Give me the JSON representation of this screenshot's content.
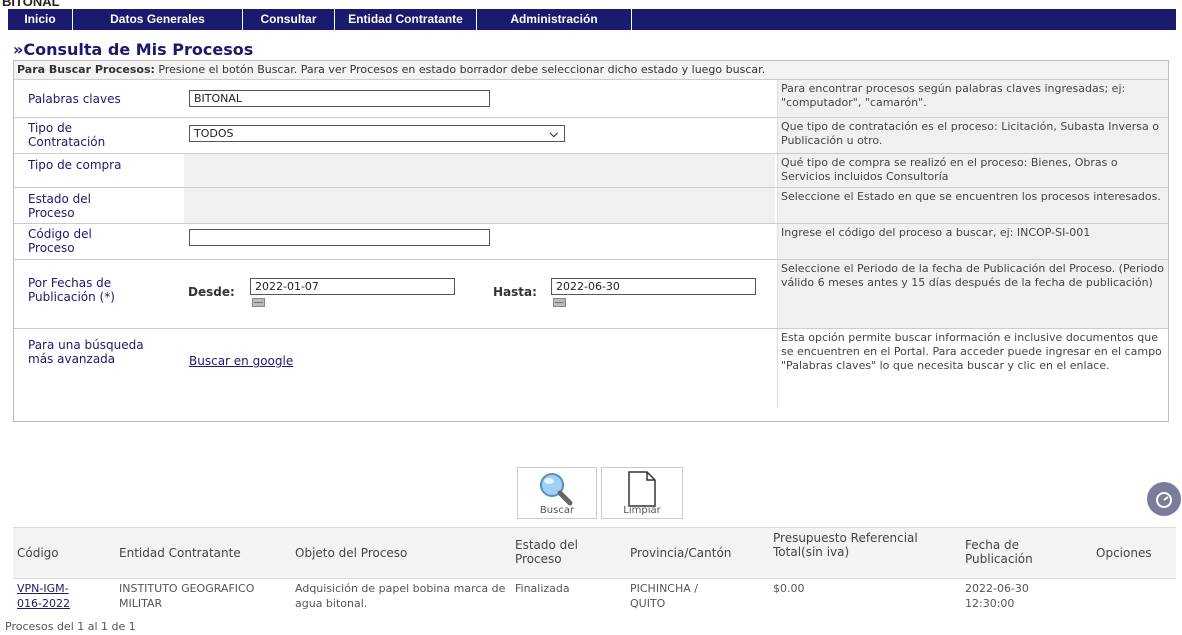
{
  "partial_heading": "BITONAL",
  "nav": [
    "Inicio",
    "Datos Generales",
    "Consultar",
    "Entidad Contratante",
    "Administración"
  ],
  "page_title": "»Consulta de Mis Procesos",
  "instructions": {
    "bold": "Para Buscar Procesos:",
    "text": " Presione el botón Buscar. Para ver Procesos en estado borrador debe seleccionar dicho estado y luego buscar."
  },
  "form": {
    "keywords": {
      "label": "Palabras claves",
      "value": "BITONAL",
      "help": "Para encontrar procesos según palabras claves ingresadas; ej: \"computador\", \"camarón\"."
    },
    "contract_type": {
      "label": "Tipo de Contratación",
      "value": "TODOS",
      "help": "Que tipo de contratación es el proceso: Licitación, Subasta Inversa o Publicación u otro."
    },
    "purchase_type": {
      "label": "Tipo de compra",
      "help": "Qué tipo de compra se realizó en el proceso: Bienes, Obras o Servicios incluidos Consultoría"
    },
    "process_state": {
      "label": "Estado del Proceso",
      "help": "Seleccione el Estado en que se encuentren los procesos interesados."
    },
    "process_code": {
      "label": "Código del Proceso",
      "value": "",
      "help": "Ingrese el código del proceso a buscar, ej: INCOP-SI-001"
    },
    "dates": {
      "label": "Por Fechas de Publicación (*)",
      "from_label": "Desde:",
      "from": "2022-01-07",
      "to_label": "Hasta:",
      "to": "2022-06-30",
      "help": "Seleccione el Periodo de la fecha de Publicación del Proceso. (Periodo válido 6 meses antes y 15 días después de la fecha de publicación)"
    },
    "advanced": {
      "label": "Para una búsqueda más avanzada",
      "link": "Buscar en google",
      "help": "Esta opción permite buscar información e inclusive documentos que se encuentren en el Portal. Para acceder puede ingresar en el campo \"Palabras claves\" lo que necesita buscar y clic en el enlace."
    }
  },
  "buttons": {
    "search": "Buscar",
    "clear": "Limpiar"
  },
  "table": {
    "headers": [
      "Código",
      "Entidad Contratante",
      "Objeto del Proceso",
      "Estado del Proceso",
      "Provincia/Cantón",
      "Presupuesto Referencial Total(sin iva)",
      "Fecha de Publicación",
      "Opciones"
    ],
    "rows": [
      {
        "code": "VPN-IGM-016-2022",
        "entity": "INSTITUTO GEOGRAFICO MILITAR",
        "object": "Adquisición de papel bobina marca de agua bitonal.",
        "state": "Finalizada",
        "location": "PICHINCHA / QUITO",
        "budget": "$0.00",
        "date": "2022-06-30 12:30:00",
        "options": ""
      }
    ]
  },
  "footer": "Procesos del 1 al 1 de 1"
}
